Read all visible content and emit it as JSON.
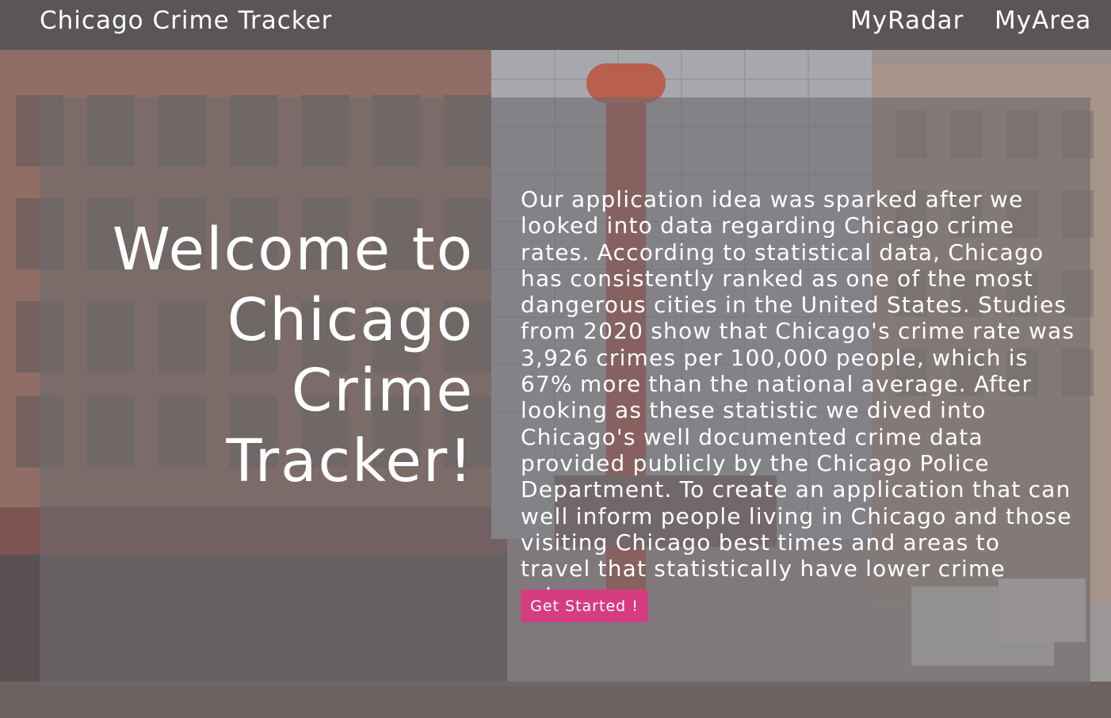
{
  "navbar": {
    "brand": "Chicago Crime Tracker",
    "links": [
      "MyRadar",
      "MyArea"
    ]
  },
  "hero": {
    "title": "Welcome to Chicago Crime Tracker!",
    "description": "Our application idea was sparked after we looked into data regarding Chicago crime rates. According to statistical data, Chicago has consistently ranked as one of the most dangerous cities in the United States. Studies from 2020 show that Chicago's crime rate was 3,926 crimes per 100,000 people, which is 67% more than the national average. After looking as these statistic we dived into Chicago's well documented crime data provided publicly by the Chicago Police Department. To create an application that can well inform people living in Chicago and those visiting Chicago best times and areas to travel that statistically have lower crime rates.",
    "cta_label": "Get Started !"
  },
  "colors": {
    "navbar_bg": "#5a5657",
    "cta_bg": "#d63d80",
    "text": "#ffffff"
  }
}
